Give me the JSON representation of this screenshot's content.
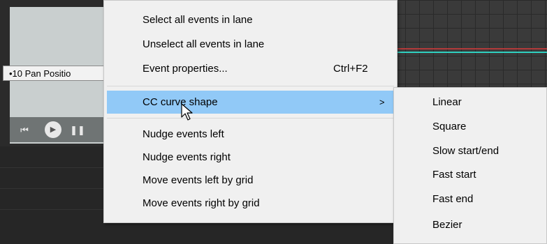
{
  "lane": {
    "selected_lane": "•10 Pan Positio",
    "transport": {
      "rewind_icon": "skip-to-start-icon",
      "play_icon": "play-icon",
      "pause_icon": "pause-icon"
    }
  },
  "context_menu": {
    "items": [
      {
        "label": "Select all events in lane",
        "shortcut": "",
        "submenu": false,
        "highlighted": false
      },
      {
        "label": "Unselect all events in lane",
        "shortcut": "",
        "submenu": false,
        "highlighted": false
      },
      {
        "label": "Event properties...",
        "shortcut": "Ctrl+F2",
        "submenu": false,
        "highlighted": false
      },
      {
        "label": "CC curve shape",
        "shortcut": "",
        "submenu": true,
        "highlighted": true
      },
      {
        "label": "Nudge events left",
        "shortcut": "",
        "submenu": false,
        "highlighted": false
      },
      {
        "label": "Nudge events right",
        "shortcut": "",
        "submenu": false,
        "highlighted": false
      },
      {
        "label": "Move events left by grid",
        "shortcut": "",
        "submenu": false,
        "highlighted": false
      },
      {
        "label": "Move events right by grid",
        "shortcut": "",
        "submenu": false,
        "highlighted": false
      }
    ],
    "submenu_arrow": ">"
  },
  "curve_submenu": {
    "items": [
      {
        "label": "Linear"
      },
      {
        "label": "Square"
      },
      {
        "label": "Slow start/end"
      },
      {
        "label": "Fast start"
      },
      {
        "label": "Fast end"
      },
      {
        "label": "Bezier"
      }
    ]
  },
  "colors": {
    "menu_bg": "#f0f0f0",
    "highlight": "#91c9f7",
    "lane_bg": "#c9cfcf",
    "curve_red": "#b23a3a",
    "curve_teal": "#2fd0c0"
  }
}
